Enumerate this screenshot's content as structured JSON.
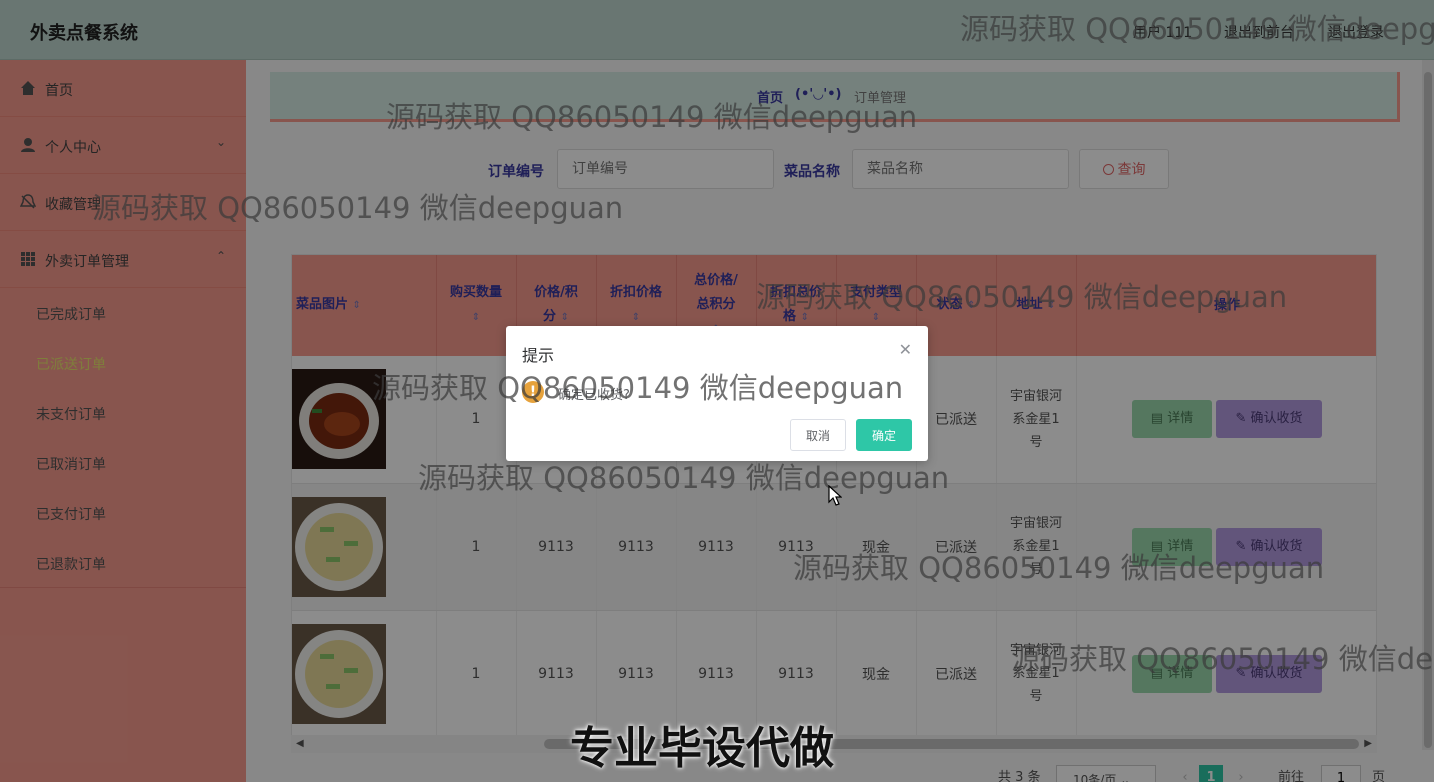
{
  "header": {
    "title": "外卖点餐系统",
    "user": "用户 111",
    "to_front": "退出到前台",
    "logout": "退出登录"
  },
  "sidebar": {
    "items": [
      {
        "label": "首页",
        "icon": "home-icon"
      },
      {
        "label": "个人中心",
        "icon": "user-icon"
      },
      {
        "label": "收藏管理",
        "icon": "bell-icon"
      },
      {
        "label": "外卖订单管理",
        "icon": "grid-icon"
      }
    ],
    "sub_items": [
      "已完成订单",
      "已派送订单",
      "未支付订单",
      "已取消订单",
      "已支付订单",
      "已退款订单"
    ],
    "active_sub": "已派送订单"
  },
  "breadcrumb": {
    "home": "首页",
    "emoji": "(•'◡'•)",
    "current": "订单管理"
  },
  "search": {
    "order_label": "订单编号",
    "order_placeholder": "订单编号",
    "dish_label": "菜品名称",
    "dish_placeholder": "菜品名称",
    "button": "查询"
  },
  "table": {
    "headers": {
      "image": "菜品图片",
      "qty": "购买数量",
      "price_1": "价格/积",
      "price_2": "分",
      "discount": "折扣价格",
      "total_1": "总价格/",
      "total_2": "总积分",
      "pay_1": "折扣总价",
      "pay_2": "格",
      "paytype": "支付类型",
      "status": "状态",
      "address": "地址",
      "action": "操作"
    },
    "rows": [
      {
        "qty": "1",
        "price": "",
        "discount": "",
        "total": "",
        "paytotal": "",
        "paytype": "",
        "status": "已派送",
        "addr1": "宇宙银河",
        "addr2": "系金星1",
        "addr3": "号"
      },
      {
        "qty": "1",
        "price": "9113",
        "discount": "9113",
        "total": "9113",
        "paytotal": "9113",
        "paytype": "现金",
        "status": "已派送",
        "addr1": "宇宙银河",
        "addr2": "系金星1",
        "addr3": "号"
      },
      {
        "qty": "1",
        "price": "9113",
        "discount": "9113",
        "total": "9113",
        "paytotal": "9113",
        "paytype": "现金",
        "status": "已派送",
        "addr1": "宇宙银河",
        "addr2": "系金星1",
        "addr3": "号"
      }
    ],
    "detail_btn": "详情",
    "confirm_btn": "确认收货"
  },
  "pagination": {
    "total": "共 3 条",
    "page_size": "10条/页",
    "current": "1",
    "goto": "前往",
    "goto_value": "1",
    "page_unit": "页"
  },
  "dialog": {
    "title": "提示",
    "message": "确定已收货?",
    "cancel": "取消",
    "ok": "确定"
  },
  "watermarks": {
    "wm1": "源码获取 QQ86050149 微信deepg",
    "wm2": "源码获取 QQ86050149 微信deepguan",
    "wm3": "源码获取 QQ86050149 微信deepguan",
    "wm4": "源码获取 QQ86050149 微信deepguan",
    "wm5": "源码获取 QQ86050149 微信deepguan",
    "wm6": "源码获取 QQ86050149 微信deepguan",
    "wm7": "源码获取 QQ86050149 微信deepguan",
    "wm8": "源码获取 QQ86050149 微信de",
    "banner": "专业毕设代做"
  },
  "colors": {
    "sidebar": "#f79c8f",
    "header": "#bfd8cf",
    "accent": "#2ec7a7",
    "confirm": "#b39be0"
  }
}
